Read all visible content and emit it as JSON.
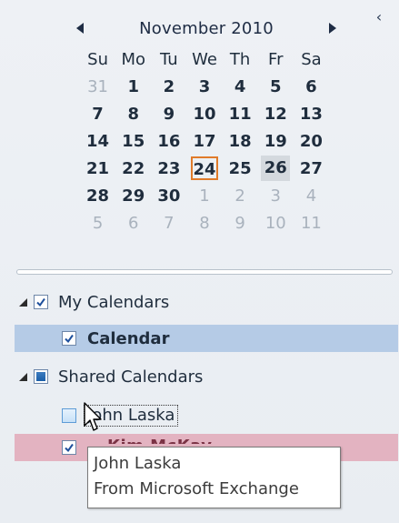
{
  "calendar": {
    "month_title": "November 2010",
    "weekdays": [
      "Su",
      "Mo",
      "Tu",
      "We",
      "Th",
      "Fr",
      "Sa"
    ],
    "weeks": [
      [
        {
          "d": "31",
          "o": true
        },
        {
          "d": "1",
          "b": true
        },
        {
          "d": "2",
          "b": true
        },
        {
          "d": "3",
          "b": true
        },
        {
          "d": "4",
          "b": true
        },
        {
          "d": "5",
          "b": true
        },
        {
          "d": "6",
          "b": true
        }
      ],
      [
        {
          "d": "7",
          "b": true
        },
        {
          "d": "8",
          "b": true
        },
        {
          "d": "9",
          "b": true
        },
        {
          "d": "10",
          "b": true
        },
        {
          "d": "11",
          "b": true
        },
        {
          "d": "12",
          "b": true
        },
        {
          "d": "13",
          "b": true
        }
      ],
      [
        {
          "d": "14",
          "b": true
        },
        {
          "d": "15",
          "b": true
        },
        {
          "d": "16",
          "b": true
        },
        {
          "d": "17",
          "b": true
        },
        {
          "d": "18",
          "b": true
        },
        {
          "d": "19",
          "b": true
        },
        {
          "d": "20",
          "b": true
        }
      ],
      [
        {
          "d": "21",
          "b": true
        },
        {
          "d": "22",
          "b": true
        },
        {
          "d": "23",
          "b": true
        },
        {
          "d": "24",
          "today": true
        },
        {
          "d": "25",
          "b": true
        },
        {
          "d": "26",
          "selected": true
        },
        {
          "d": "27",
          "b": true
        }
      ],
      [
        {
          "d": "28",
          "b": true
        },
        {
          "d": "29",
          "b": true
        },
        {
          "d": "30",
          "b": true
        },
        {
          "d": "1",
          "o": true
        },
        {
          "d": "2",
          "o": true
        },
        {
          "d": "3",
          "o": true
        },
        {
          "d": "4",
          "o": true
        }
      ],
      [
        {
          "d": "5",
          "o": true
        },
        {
          "d": "6",
          "o": true
        },
        {
          "d": "7",
          "o": true
        },
        {
          "d": "8",
          "o": true
        },
        {
          "d": "9",
          "o": true
        },
        {
          "d": "10",
          "o": true
        },
        {
          "d": "11",
          "o": true
        }
      ]
    ]
  },
  "my_calendars": {
    "label": "My Calendars",
    "items": [
      {
        "label": "Calendar",
        "checked": true
      }
    ]
  },
  "shared_calendars": {
    "label": "Shared Calendars",
    "items": [
      {
        "label": "John Laska",
        "checked": false
      },
      {
        "label": "Kim McKay",
        "checked": true
      }
    ]
  },
  "tooltip": {
    "line1": "John Laska",
    "line2": "From Microsoft Exchange"
  },
  "icons": {
    "prev": "triangle-left-icon",
    "next": "triangle-right-icon",
    "collapse": "chevron-left-icon",
    "expander": "expanded-triangle-icon",
    "check": "check-icon"
  },
  "colors": {
    "today_border": "#e07b2a",
    "selected_row": "#b5cbe6",
    "shared_row": "#e3b3c1",
    "selected_day": "#d4d9de"
  }
}
